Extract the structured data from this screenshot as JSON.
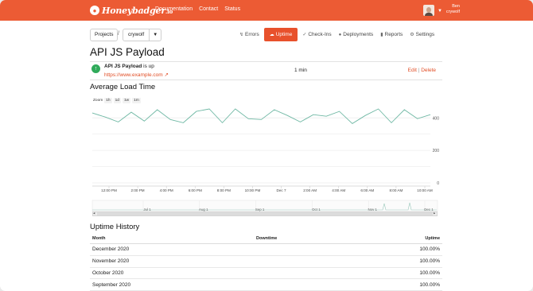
{
  "brand": {
    "name": "Honeybadger",
    "suffix": ".io"
  },
  "topnav": {
    "documentation": "Documentation",
    "contact": "Contact",
    "status": "Status"
  },
  "user": {
    "name": "Ben",
    "team": "crywolf"
  },
  "breadcrumb": {
    "projects": "Projects",
    "separator": "/",
    "project": "crywolf"
  },
  "tabs": {
    "errors": "Errors",
    "uptime": "Uptime",
    "checkins": "Check-Ins",
    "deployments": "Deployments",
    "reports": "Reports",
    "settings": "Settings"
  },
  "page": {
    "title": "API JS Payload"
  },
  "check": {
    "name": "API JS Payload",
    "state_text": "is up",
    "url": "https://www.example.com",
    "interval": "1 min",
    "edit": "Edit",
    "separator": "|",
    "delete": "Delete"
  },
  "load": {
    "title": "Average Load Time",
    "zoom_label": "Zoom",
    "zoom_options": [
      "1h",
      "1d",
      "1w",
      "1m"
    ]
  },
  "chart_data": {
    "type": "line",
    "title": "Average Load Time",
    "x_labels": [
      "12:00 PM",
      "2:00 PM",
      "4:00 PM",
      "6:00 PM",
      "8:00 PM",
      "10:00 PM",
      "Dec 7",
      "2:00 AM",
      "4:00 AM",
      "6:00 AM",
      "8:00 AM",
      "10:00 AM"
    ],
    "y_ticks": [
      0,
      200,
      400
    ],
    "ylim": [
      0,
      460
    ],
    "series": [
      {
        "color": "#6fb8a4",
        "values": [
          430,
          405,
          375,
          435,
          380,
          450,
          390,
          370,
          440,
          455,
          370,
          455,
          395,
          390,
          450,
          415,
          375,
          420,
          410,
          440,
          365,
          415,
          455,
          370,
          450,
          395,
          420
        ]
      }
    ],
    "navigator_labels": [
      "Jul 1",
      "Aug 1",
      "Sep 1",
      "Oct 1",
      "Nov 1",
      "Dec 1"
    ],
    "grid": true
  },
  "history": {
    "title": "Uptime History",
    "columns": [
      "Month",
      "Downtime",
      "Uptime"
    ],
    "rows": [
      {
        "month": "December 2020",
        "downtime": "",
        "uptime": "100.00%"
      },
      {
        "month": "November 2020",
        "downtime": "",
        "uptime": "100.00%"
      },
      {
        "month": "October 2020",
        "downtime": "",
        "uptime": "100.00%"
      },
      {
        "month": "September 2020",
        "downtime": "",
        "uptime": "100.00%"
      }
    ]
  },
  "colors": {
    "brand": "#ec5b34",
    "link": "#e14d25",
    "up": "#2faa5a",
    "line": "#6fb8a4"
  }
}
